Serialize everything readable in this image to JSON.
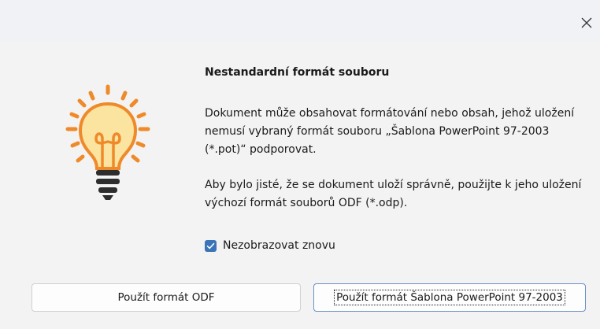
{
  "dialog": {
    "close_label": "×",
    "heading": "Nestandardní formát souboru",
    "paragraph1": "Dokument může obsahovat formátování nebo obsah, jehož uložení nemusí vybraný formát souboru „Šablona PowerPoint 97-2003 (*.pot)“ podporovat.",
    "paragraph2": "Aby bylo jisté, že se dokument uloží správně, použijte k jeho uložení výchozí formát souborů ODF (*.odp).",
    "checkbox_label": "Nezobrazovat znovu",
    "checkbox_checked": true,
    "button_odf": "Použít formát ODF",
    "button_pot": "Použít formát Šablona PowerPoint 97-2003"
  },
  "icons": {
    "close": "close-icon",
    "bulb": "lightbulb-icon",
    "check": "checkmark-icon"
  },
  "colors": {
    "bulb_fill": "#fbe3a0",
    "bulb_outline": "#ef8a2a",
    "bulb_base": "#2d2d2d",
    "checkbox": "#3b74b8",
    "focus_border": "#6a8fc8"
  }
}
